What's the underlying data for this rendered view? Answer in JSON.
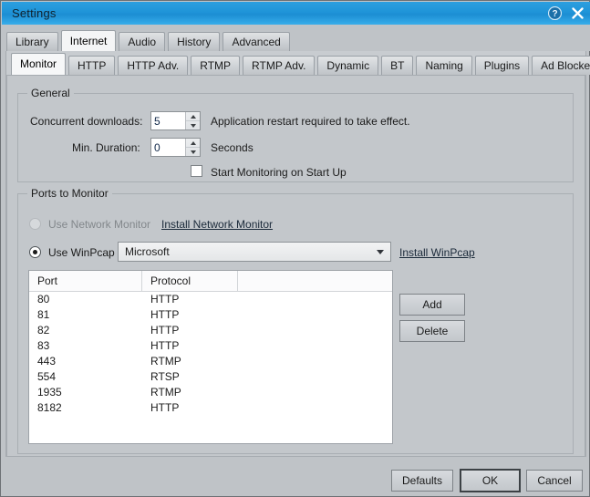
{
  "window": {
    "title": "Settings",
    "help_icon": "help-icon",
    "close_icon": "close-icon"
  },
  "outer_tabs": [
    {
      "label": "Library",
      "active": false
    },
    {
      "label": "Internet",
      "active": true
    },
    {
      "label": "Audio",
      "active": false
    },
    {
      "label": "History",
      "active": false
    },
    {
      "label": "Advanced",
      "active": false
    }
  ],
  "inner_tabs": [
    {
      "label": "Monitor",
      "active": true
    },
    {
      "label": "HTTP",
      "active": false
    },
    {
      "label": "HTTP Adv.",
      "active": false
    },
    {
      "label": "RTMP",
      "active": false
    },
    {
      "label": "RTMP Adv.",
      "active": false
    },
    {
      "label": "Dynamic",
      "active": false
    },
    {
      "label": "BT",
      "active": false
    },
    {
      "label": "Naming",
      "active": false
    },
    {
      "label": "Plugins",
      "active": false
    },
    {
      "label": "Ad Blocker",
      "active": false
    }
  ],
  "general": {
    "legend": "General",
    "concurrent_downloads": {
      "label": "Concurrent downloads:",
      "value": "5",
      "hint": "Application restart required to take effect."
    },
    "min_duration": {
      "label": "Min. Duration:",
      "value": "0",
      "unit": "Seconds"
    },
    "start_monitoring": {
      "label": "Start Monitoring on Start Up",
      "checked": false
    }
  },
  "ports": {
    "legend": "Ports to Monitor",
    "network_monitor": {
      "label": "Use Network Monitor",
      "selected": false,
      "disabled": true,
      "link": "Install Network Monitor"
    },
    "winpcap": {
      "label": "Use WinPcap",
      "selected": true,
      "adapter_value": "Microsoft",
      "link": "Install WinPcap"
    },
    "table": {
      "columns": [
        "Port",
        "Protocol",
        ""
      ],
      "rows": [
        [
          "80",
          "HTTP",
          ""
        ],
        [
          "81",
          "HTTP",
          ""
        ],
        [
          "82",
          "HTTP",
          ""
        ],
        [
          "83",
          "HTTP",
          ""
        ],
        [
          "443",
          "RTMP",
          ""
        ],
        [
          "554",
          "RTSP",
          ""
        ],
        [
          "1935",
          "RTMP",
          ""
        ],
        [
          "8182",
          "HTTP",
          ""
        ]
      ]
    },
    "add_label": "Add",
    "delete_label": "Delete"
  },
  "footer": {
    "defaults_label": "Defaults",
    "ok_label": "OK",
    "cancel_label": "Cancel"
  },
  "colors": {
    "titlebar_accent": "#1f94d8",
    "dialog_bg": "#c3c7cb",
    "field_bg": "#ffffff",
    "text": "#1b1b1b",
    "disabled_text": "#83888c"
  }
}
